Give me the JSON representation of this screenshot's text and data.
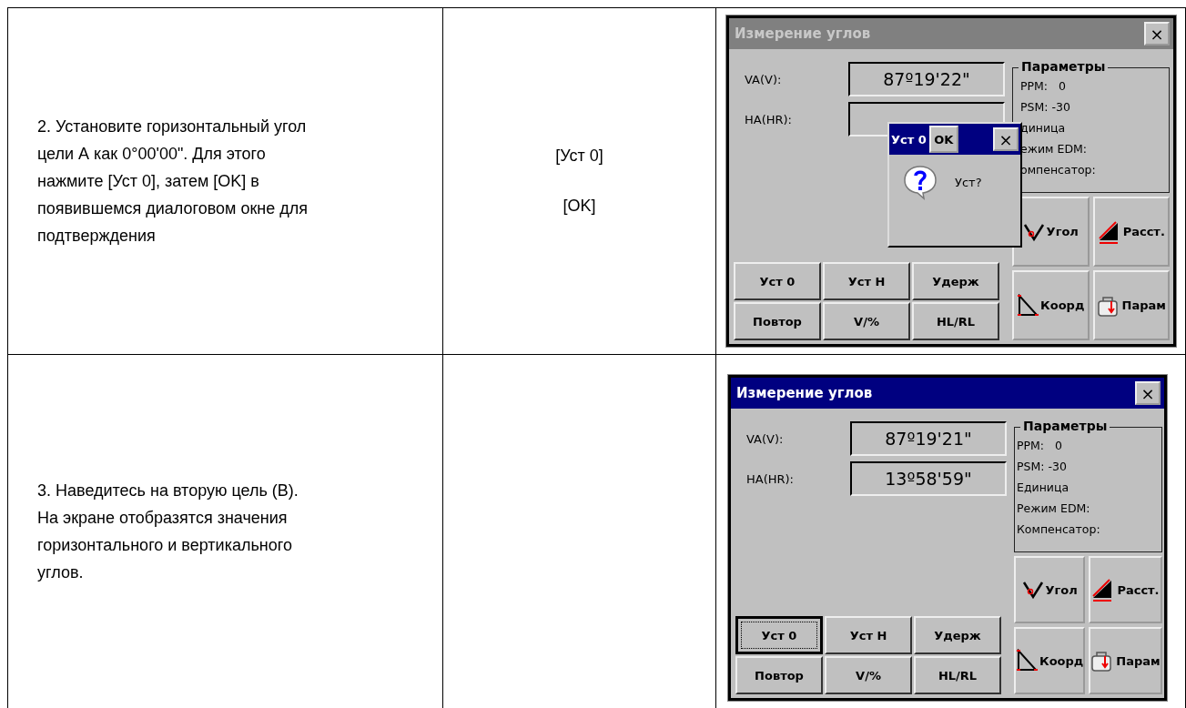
{
  "rows": [
    {
      "instruction": "2. Установите горизонтальный угол\nцели А как 0°00'00\". Для этого\nнажмите [Уст 0], затем [OK] в\nпоявившемся диалоговом окне для\nподтверждения",
      "keys": [
        "[Уст 0]",
        "[OK]"
      ],
      "screen": {
        "title": "Измерение углов",
        "active": false,
        "close": "×",
        "fields": [
          {
            "label": "VA(V):",
            "value": "87º19'22\""
          },
          {
            "label": "HA(HR):"
          }
        ],
        "params": {
          "title": "Параметры",
          "lines": [
            "PPM:   0",
            "PSM: -30",
            "диница",
            "ежим EDM:",
            "омпенсатор:"
          ]
        },
        "buttons": [
          {
            "label": "Уст 0",
            "focused": false
          },
          {
            "label": "Уст Н",
            "focused": false
          },
          {
            "label": "Удерж",
            "focused": false
          },
          {
            "label": "Повтор",
            "focused": false
          },
          {
            "label": "V/%",
            "focused": false
          },
          {
            "label": "HL/RL",
            "focused": false
          }
        ],
        "tiles": [
          {
            "label": "Угол",
            "kind": "angle"
          },
          {
            "label": "Расст.",
            "kind": "distance"
          },
          {
            "label": "Коорд",
            "kind": "coords"
          },
          {
            "label": "Парам",
            "kind": "params"
          }
        ],
        "dialog": {
          "title": "Уст 0",
          "ok": "OK",
          "close": "×",
          "message": "Уст?"
        }
      }
    },
    {
      "instruction": "3. Наведитесь на вторую цель (В).\nНа экране отобразятся значения\nгоризонтального и вертикального\nуглов.",
      "keys": [],
      "screen": {
        "title": "Измерение углов",
        "active": true,
        "close": "×",
        "fields": [
          {
            "label": "VA(V):",
            "value": "87º19'21\""
          },
          {
            "label": "HA(HR):",
            "value": "13º58'59\""
          }
        ],
        "params": {
          "title": "Параметры",
          "lines": [
            "PPM:   0",
            "PSM: -30",
            "Единица",
            "Режим EDM:",
            "Компенсатор:"
          ]
        },
        "buttons": [
          {
            "label": "Уст 0",
            "focused": true
          },
          {
            "label": "Уст Н",
            "focused": false
          },
          {
            "label": "Удерж",
            "focused": false
          },
          {
            "label": "Повтор",
            "focused": false
          },
          {
            "label": "V/%",
            "focused": false
          },
          {
            "label": "HL/RL",
            "focused": false
          }
        ],
        "tiles": [
          {
            "label": "Угол",
            "kind": "angle"
          },
          {
            "label": "Расст.",
            "kind": "distance"
          },
          {
            "label": "Коорд",
            "kind": "coords"
          },
          {
            "label": "Парам",
            "kind": "params"
          }
        ]
      }
    }
  ]
}
